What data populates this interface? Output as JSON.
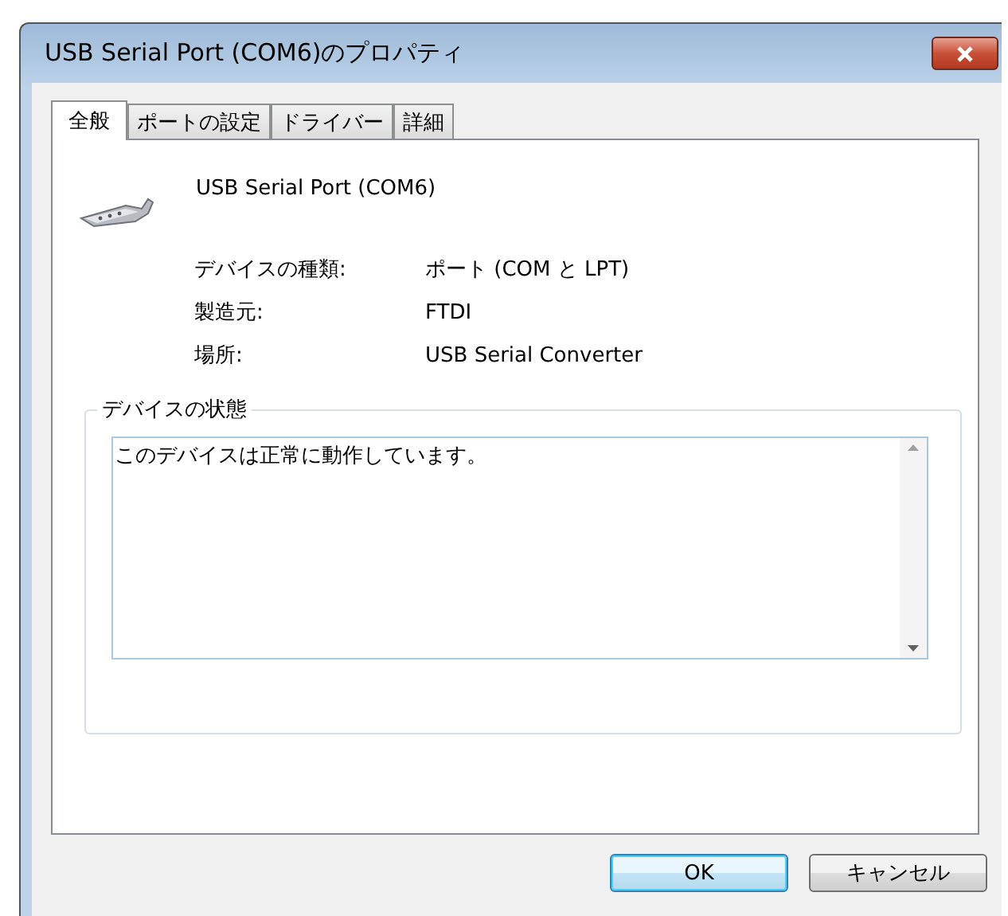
{
  "window": {
    "title": "USB Serial Port (COM6)のプロパティ"
  },
  "tabs": [
    {
      "label": "全般",
      "selected": true
    },
    {
      "label": "ポートの設定",
      "selected": false
    },
    {
      "label": "ドライバー",
      "selected": false
    },
    {
      "label": "詳細",
      "selected": false
    }
  ],
  "device": {
    "name": "USB Serial Port (COM6)"
  },
  "properties": [
    {
      "label": "デバイスの種類:",
      "value": "ポート (COM と LPT)"
    },
    {
      "label": "製造元:",
      "value": "FTDI"
    },
    {
      "label": "場所:",
      "value": "USB Serial Converter"
    }
  ],
  "status": {
    "title": "デバイスの状態",
    "text": "このデバイスは正常に動作しています。"
  },
  "buttons": [
    {
      "label": "OK",
      "default": true
    },
    {
      "label": "キャンセル",
      "default": false
    }
  ]
}
